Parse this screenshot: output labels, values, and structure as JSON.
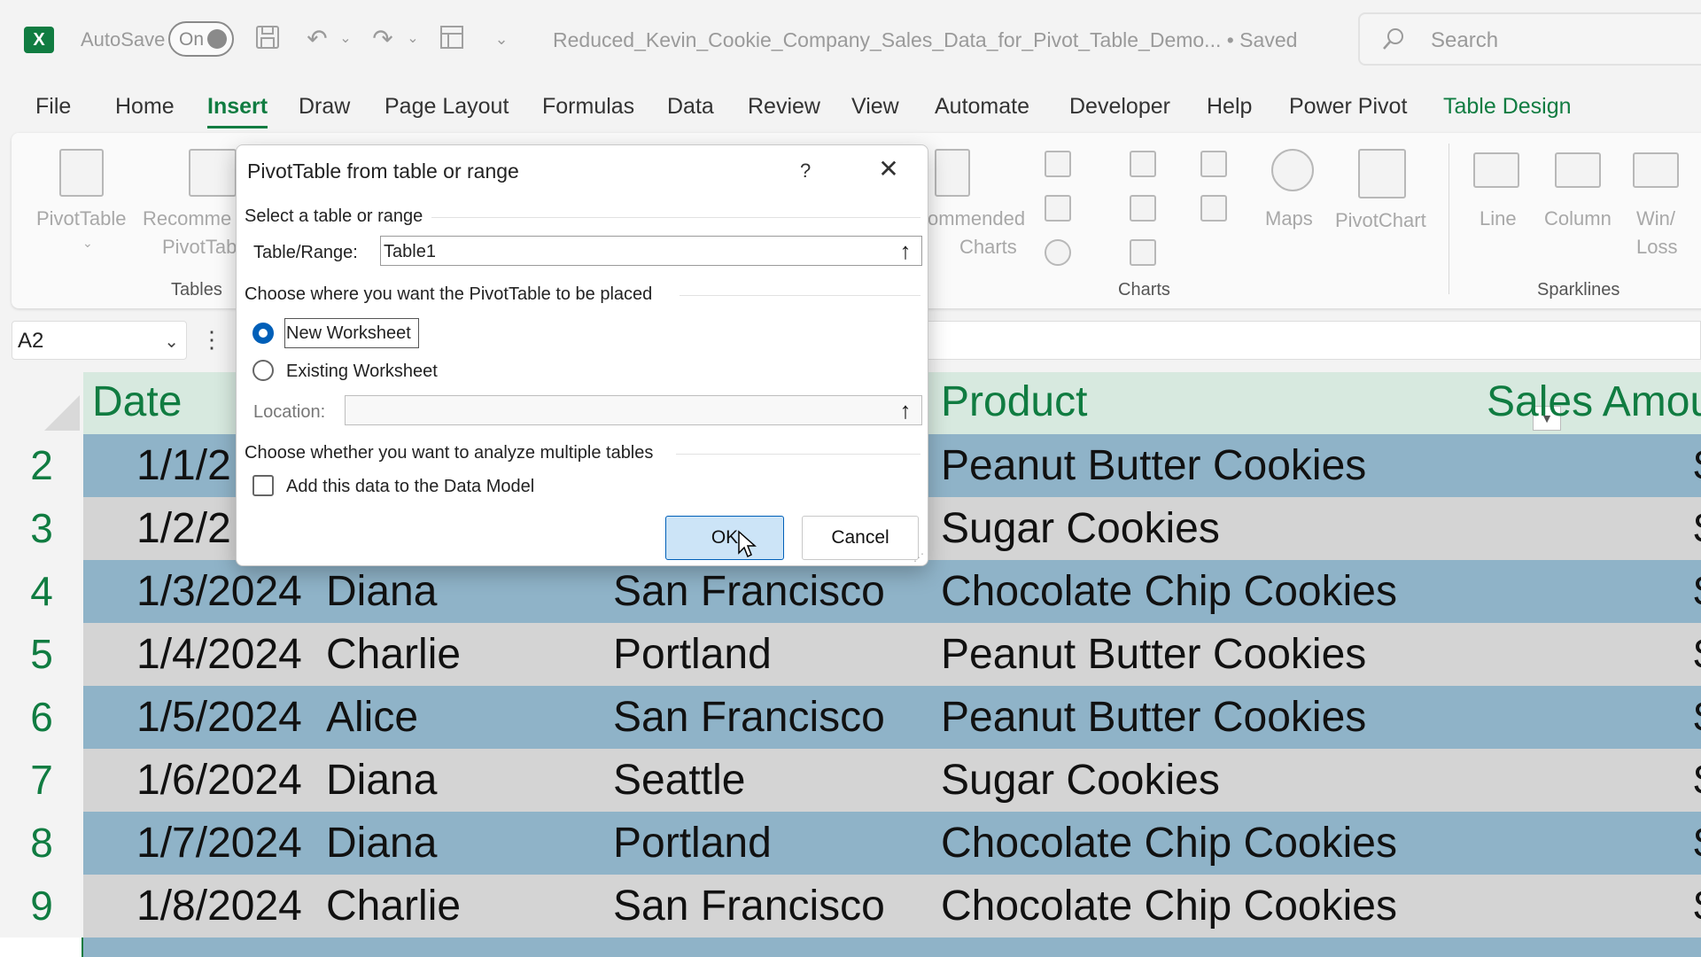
{
  "titlebar": {
    "autosave_label": "AutoSave",
    "autosave_state": "On",
    "doc_title": "Reduced_Kevin_Cookie_Company_Sales_Data_for_Pivot_Table_Demo...  •  Saved",
    "search_placeholder": "Search"
  },
  "tabs": [
    "File",
    "Home",
    "Insert",
    "Draw",
    "Page Layout",
    "Formulas",
    "Data",
    "Review",
    "View",
    "Automate",
    "Developer",
    "Help",
    "Power Pivot",
    "Table Design"
  ],
  "active_tab": "Insert",
  "ribbon": {
    "pivottable": "PivotTable",
    "recommended_1": "Recomme",
    "recommended_2": "PivotTab",
    "tables_group": "Tables",
    "rec_charts_1": "ommended",
    "rec_charts_2": "Charts",
    "charts_group": "Charts",
    "maps": "Maps",
    "pivotchart": "PivotChart",
    "line": "Line",
    "column": "Column",
    "winloss_1": "Win/",
    "winloss_2": "Loss",
    "sparklines_group": "Sparklines"
  },
  "namebox": "A2",
  "sheet": {
    "headers": {
      "date": "Date",
      "product": "Product",
      "sales": "Sales Amou"
    },
    "rows": [
      {
        "num": "2",
        "date": "1/1/2",
        "name": "",
        "city": "",
        "product": "Peanut Butter Cookies"
      },
      {
        "num": "3",
        "date": "1/2/2",
        "name": "",
        "city": "",
        "product": "Sugar Cookies"
      },
      {
        "num": "4",
        "date": "1/3/2024",
        "name": "Diana",
        "city": "San Francisco",
        "product": "Chocolate Chip Cookies"
      },
      {
        "num": "5",
        "date": "1/4/2024",
        "name": "Charlie",
        "city": "Portland",
        "product": "Peanut Butter Cookies"
      },
      {
        "num": "6",
        "date": "1/5/2024",
        "name": "Alice",
        "city": "San Francisco",
        "product": "Peanut Butter Cookies"
      },
      {
        "num": "7",
        "date": "1/6/2024",
        "name": "Diana",
        "city": "Seattle",
        "product": "Sugar Cookies"
      },
      {
        "num": "8",
        "date": "1/7/2024",
        "name": "Diana",
        "city": "Portland",
        "product": "Chocolate Chip Cookies"
      },
      {
        "num": "9",
        "date": "1/8/2024",
        "name": "Charlie",
        "city": "San Francisco",
        "product": "Chocolate Chip Cookies"
      }
    ]
  },
  "dialog": {
    "title": "PivotTable from table or range",
    "help": "?",
    "close": "✕",
    "select_label": "Select a table or range",
    "range_label": "Table/Range:",
    "range_value": "Table1",
    "placement_label": "Choose where you want the PivotTable to be placed",
    "new_ws": "New Worksheet",
    "existing_ws": "Existing Worksheet",
    "location_label": "Location:",
    "location_value": "",
    "multi_label": "Choose whether you want to analyze multiple tables",
    "data_model": "Add this data to the Data Model",
    "ok": "OK",
    "cancel": "Cancel"
  },
  "colors": {
    "accent": "#107c41",
    "row_blue": "#8fb3c8",
    "row_gray": "#d4d4d4",
    "dialog_primary": "#005fb8"
  }
}
